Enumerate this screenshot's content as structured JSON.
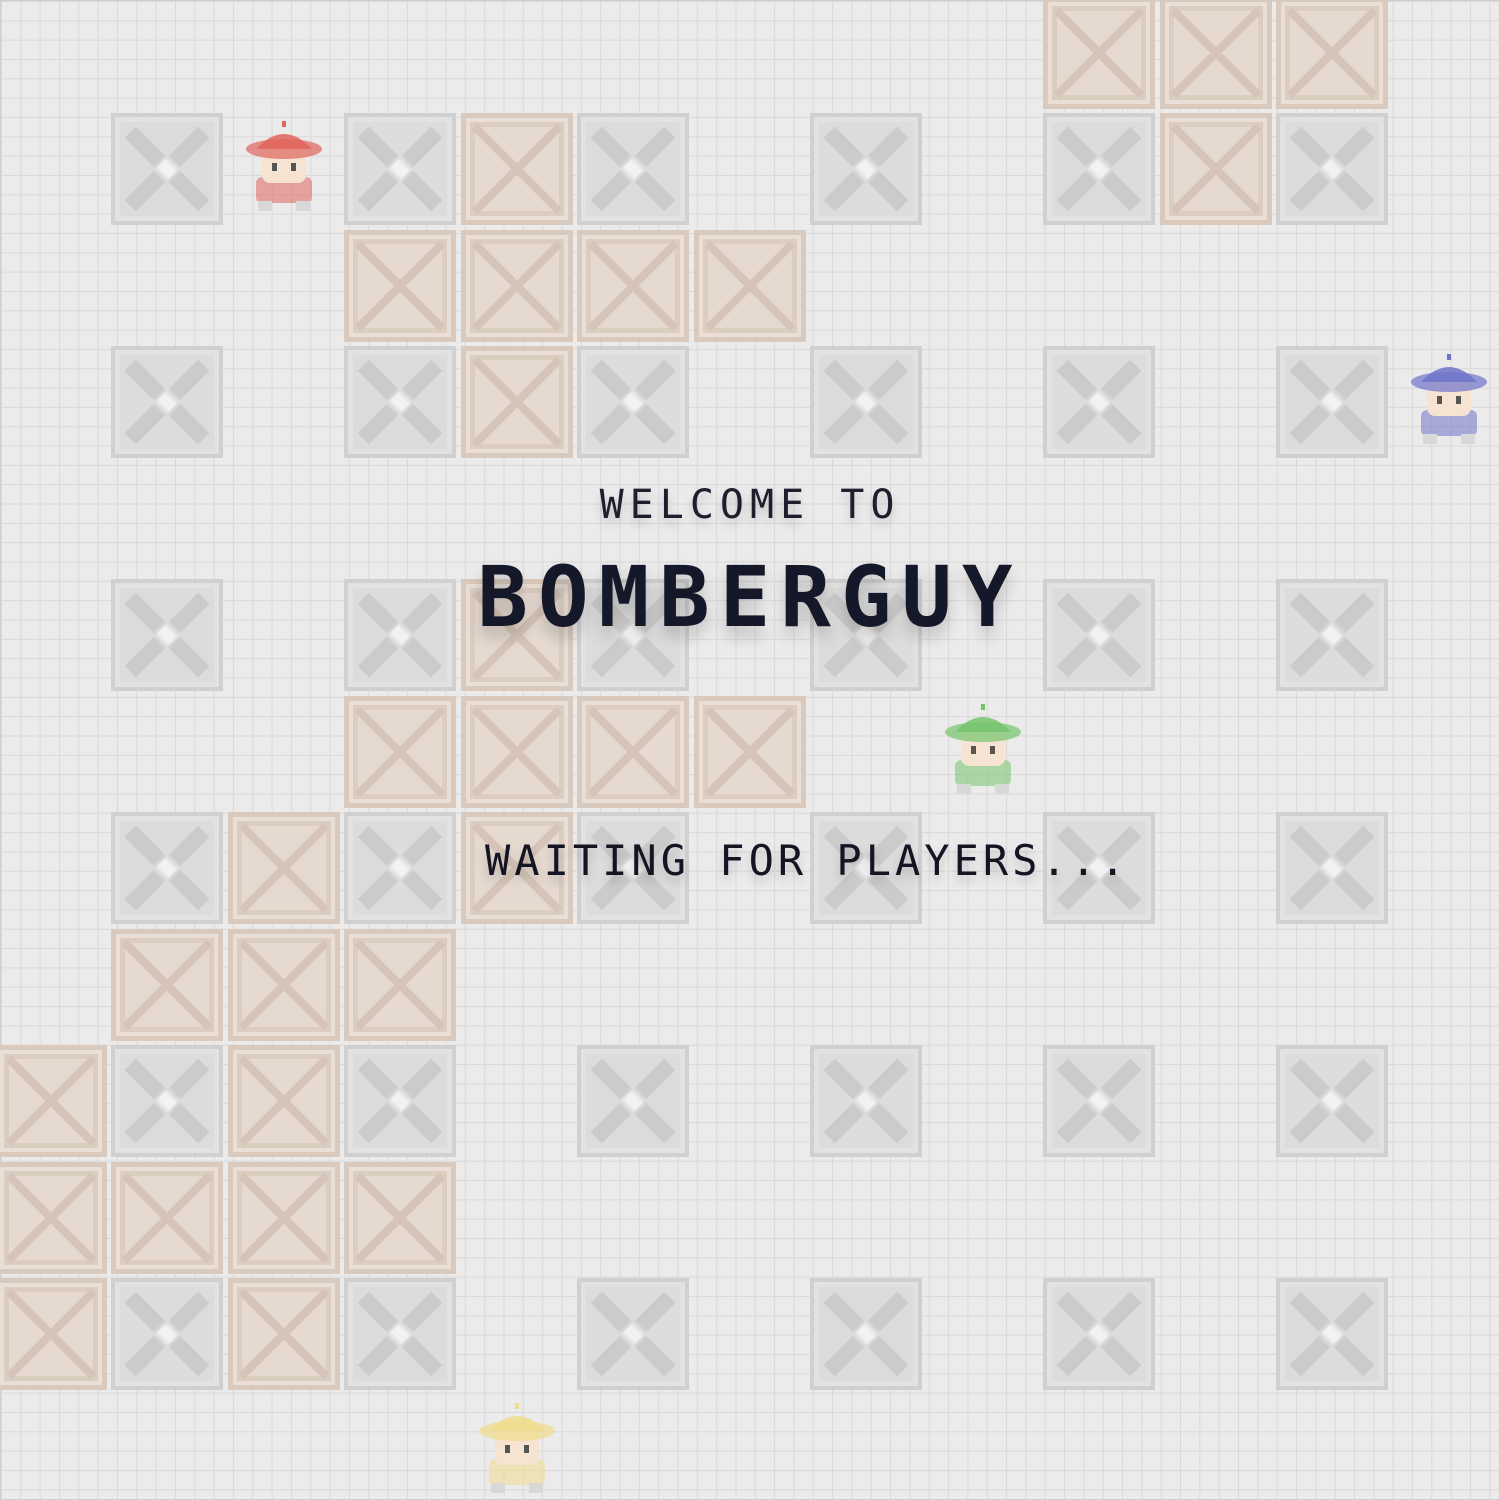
{
  "screen": {
    "welcome": "WELCOME TO",
    "title": "BOMBERGUY",
    "status": "WAITING FOR PLAYERS..."
  },
  "colors": {
    "red": "#e0655c",
    "blue": "#6f73c9",
    "green": "#75c46c",
    "yellow": "#f0dc8c"
  },
  "grid": {
    "columns": 13,
    "rows": 13,
    "pillar_cells": [
      [
        1,
        1
      ],
      [
        1,
        3
      ],
      [
        1,
        5
      ],
      [
        1,
        7
      ],
      [
        1,
        9
      ],
      [
        1,
        11
      ],
      [
        3,
        1
      ],
      [
        3,
        3
      ],
      [
        3,
        5
      ],
      [
        3,
        7
      ],
      [
        3,
        9
      ],
      [
        3,
        11
      ],
      [
        5,
        1
      ],
      [
        5,
        3
      ],
      [
        5,
        5
      ],
      [
        5,
        7
      ],
      [
        5,
        9
      ],
      [
        5,
        11
      ],
      [
        7,
        1
      ],
      [
        7,
        3
      ],
      [
        7,
        5
      ],
      [
        7,
        7
      ],
      [
        7,
        9
      ],
      [
        7,
        11
      ],
      [
        9,
        1
      ],
      [
        9,
        3
      ],
      [
        9,
        5
      ],
      [
        9,
        7
      ],
      [
        9,
        9
      ],
      [
        9,
        11
      ],
      [
        11,
        1
      ],
      [
        11,
        3
      ],
      [
        11,
        5
      ],
      [
        11,
        7
      ],
      [
        11,
        9
      ],
      [
        11,
        11
      ]
    ],
    "crate_cells": [
      [
        9,
        0
      ],
      [
        10,
        0
      ],
      [
        11,
        0
      ],
      [
        4,
        1
      ],
      [
        10,
        1
      ],
      [
        3,
        2
      ],
      [
        4,
        2
      ],
      [
        5,
        2
      ],
      [
        6,
        2
      ],
      [
        4,
        3
      ],
      [
        4,
        5
      ],
      [
        3,
        6
      ],
      [
        4,
        6
      ],
      [
        5,
        6
      ],
      [
        6,
        6
      ],
      [
        2,
        7
      ],
      [
        4,
        7
      ],
      [
        1,
        8
      ],
      [
        2,
        8
      ],
      [
        3,
        8
      ],
      [
        0,
        9
      ],
      [
        2,
        9
      ],
      [
        0,
        10
      ],
      [
        1,
        10
      ],
      [
        2,
        10
      ],
      [
        3,
        10
      ],
      [
        0,
        11
      ],
      [
        2,
        11
      ]
    ],
    "players": [
      {
        "id": "red",
        "col": 2,
        "row": 1
      },
      {
        "id": "blue",
        "col": 12,
        "row": 3
      },
      {
        "id": "green",
        "col": 8,
        "row": 6
      },
      {
        "id": "yellow",
        "col": 4,
        "row": 12
      }
    ]
  }
}
